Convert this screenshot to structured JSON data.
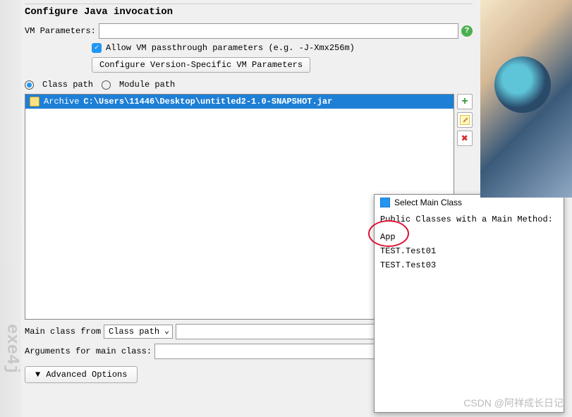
{
  "sidebar_brand": "exe4j",
  "section": {
    "title": "Configure Java invocation",
    "vm_label": "VM Parameters:",
    "vm_value": "",
    "allow_passthrough_label": "Allow VM passthrough parameters (e.g. -J-Xmx256m)",
    "configure_version_btn": "Configure Version-Specific VM Parameters",
    "classpath_label": "Class path",
    "modulepath_label": "Module path",
    "archive_label": "Archive",
    "archive_path": "C:\\Users\\11446\\Desktop\\untitled2-1.0-SNAPSHOT.jar",
    "main_class_from_label": "Main class from",
    "main_class_from_value": "Class path",
    "main_class_value": "",
    "arguments_label": "Arguments for main class:",
    "arguments_value": "",
    "advanced_label": "Advanced Options"
  },
  "popup": {
    "title": "Select Main Class",
    "subtitle": "Public Classes with a Main Method:",
    "items": [
      "App",
      "TEST.Test01",
      "TEST.Test03"
    ]
  },
  "watermark": "CSDN @阿祥成长日记"
}
